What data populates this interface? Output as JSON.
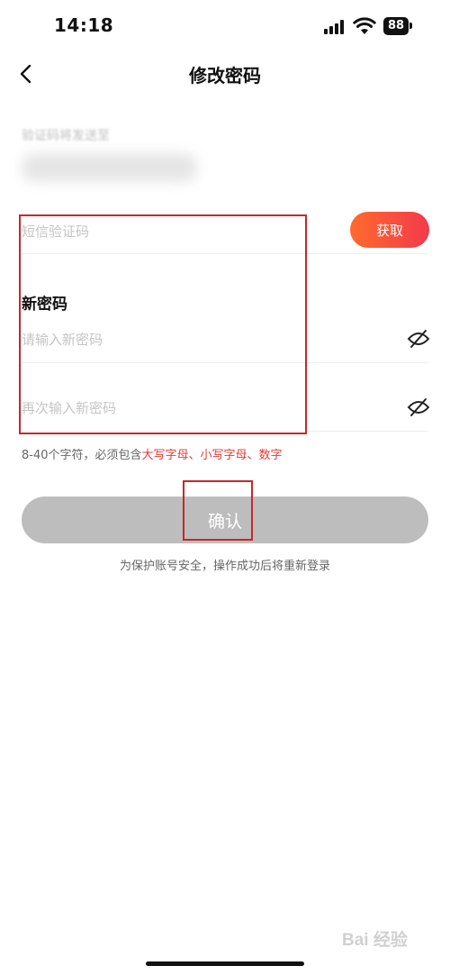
{
  "status_bar": {
    "time": "14:18",
    "battery": "88",
    "icons": [
      "signal-icon",
      "wifi-icon",
      "battery-icon"
    ]
  },
  "header": {
    "title": "修改密码",
    "back_icon": "chevron-left-icon"
  },
  "phone": {
    "label": "验证码将发送至"
  },
  "sms": {
    "placeholder": "短信验证码",
    "get_code_label": "获取",
    "button_gradient": [
      "#ff6a2d",
      "#f23a4b"
    ]
  },
  "new_password": {
    "title": "新密码",
    "input1_placeholder": "请输入新密码",
    "input2_placeholder": "再次输入新密码",
    "eye_icon": "eye-off-icon"
  },
  "hint": {
    "prefix": "8-40个字符，必须包含",
    "highlight": "大写字母、小写字母、数字",
    "highlight_color": "#e53935"
  },
  "confirm": {
    "label": "确认",
    "color": "#bdbdbd"
  },
  "notice": "为保护账号安全，操作成功后将重新登录",
  "watermark": "Bai 经验"
}
